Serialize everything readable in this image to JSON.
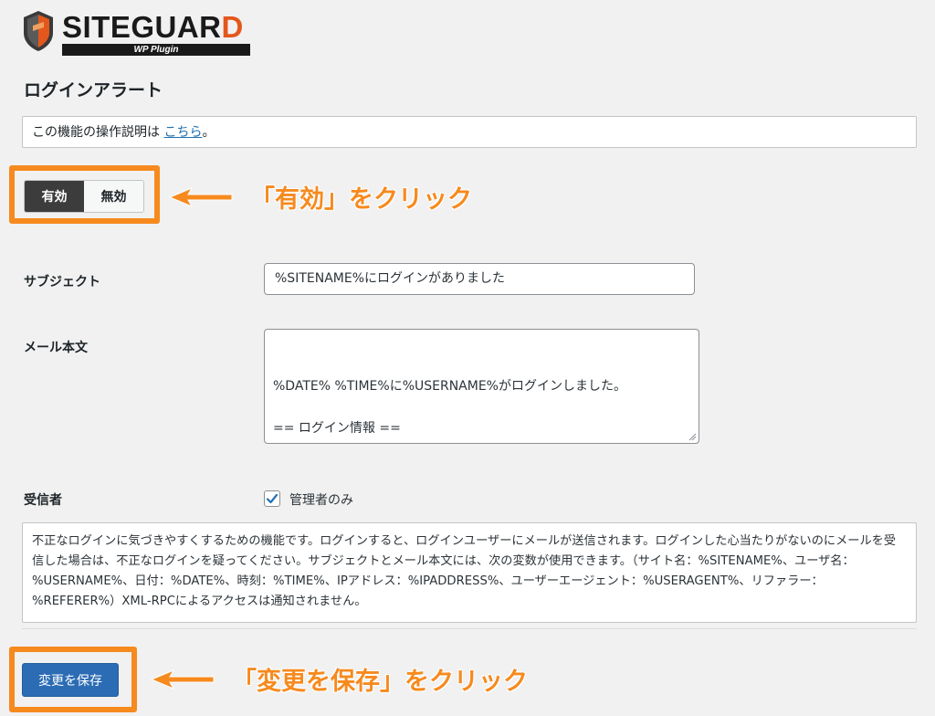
{
  "logo": {
    "brand_main": "SITEGUAR",
    "brand_accent": "D",
    "subtitle": "WP Plugin"
  },
  "page_title": "ログインアラート",
  "help": {
    "prefix": "この機能の操作説明は ",
    "link_text": "こちら",
    "suffix": "。"
  },
  "toggle": {
    "on_label": "有効",
    "off_label": "無効",
    "selected": "有効"
  },
  "callouts": {
    "toggle": "「有効」をクリック",
    "save": "「変更を保存」をクリック"
  },
  "form": {
    "subject_label": "サブジェクト",
    "subject_value": "%SITENAME%にログインがありました",
    "body_label": "メール本文",
    "body_value": "%DATE% %TIME%に%USERNAME%がログインしました。\n\n== ログイン情報 ==\nIPアドレス：%IPADDRESS%\nリファラー：%REFERER%",
    "recipient_label": "受信者",
    "recipient_option": "管理者のみ",
    "recipient_checked": true
  },
  "description": "不正なログインに気づきやすくするための機能です。ログインすると、ログインユーザーにメールが送信されます。ログインした心当たりがないのにメールを受信した場合は、不正なログインを疑ってください。サブジェクトとメール本文には、次の変数が使用できます。（サイト名：%SITENAME%、ユーザ名：%USERNAME%、日付：%DATE%、時刻：%TIME%、IPアドレス：%IPADDRESS%、ユーザーエージェント：%USERAGENT%、リファラー：%REFERER%）XML-RPCによるアクセスは通知されません。",
  "save_label": "変更を保存",
  "colors": {
    "highlight": "#f68a1e",
    "primary_button": "#2c6cb4",
    "link": "#2271b1",
    "toggle_active": "#3c3c3c",
    "brand_accent": "#e3571c"
  },
  "icons": {
    "logo": "shield-logo-icon",
    "callout_arrow": "orange-arrow-icon",
    "checkbox": "checkmark-icon",
    "resize": "resize-grip-icon"
  }
}
